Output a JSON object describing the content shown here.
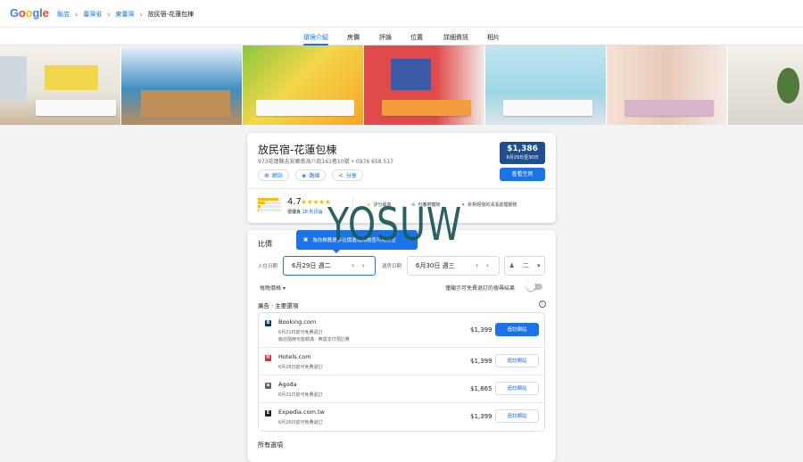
{
  "header": {
    "logo_letters": [
      "G",
      "o",
      "o",
      "g",
      "l",
      "e"
    ],
    "logo_colors": [
      "#4285f4",
      "#ea4335",
      "#fbbc05",
      "#4285f4",
      "#34a853",
      "#ea4335"
    ],
    "breadcrumbs": [
      "飯店",
      "臺灣省",
      "東臺灣",
      "放民宿-花蓮包棟"
    ]
  },
  "tabs": [
    "環境介紹",
    "房價",
    "評論",
    "位置",
    "詳細資訊",
    "相片"
  ],
  "active_tab": 0,
  "hotel": {
    "name": "放民宿-花蓮包棟",
    "address": "973花蓮縣吉安鄉南海八街161巷10號 • 0976 658 517",
    "price": "$1,386",
    "price_dates": "6月29日至30日",
    "check_label": "查看空房",
    "actions": [
      {
        "label": "網站",
        "icon": "globe-icon"
      },
      {
        "label": "路線",
        "icon": "directions-icon"
      },
      {
        "label": "分享",
        "icon": "share-icon"
      }
    ],
    "rating": "4.7",
    "stars": "★★★★★",
    "rating_label": "很優良",
    "rating_count": "28 則評論",
    "amenities": [
      "評分最高",
      "可攜帶寵物",
      "針對經營的清潔處理服務"
    ]
  },
  "compare": {
    "title": "比價",
    "tooltip": "為你推薦更多比價選項和檢查可用房型",
    "checkin_label": "入住日期",
    "checkin_value": "6月29日 週二",
    "checkout_label": "退房日期",
    "checkout_value": "6月30日 週三",
    "guests_value": "二",
    "nightly_label": "每晚價格",
    "free_cancel_label": "僅顯示可免費退訂的搜尋結果",
    "ad_label": "廣告 · 主要選項",
    "offers": [
      {
        "name": "Booking.com",
        "note1": "6月21日前可免費退訂",
        "note2": "飯店隨時可能額滿 · 無需支付預訂費",
        "price": "$1,399",
        "button": "造訪網站",
        "icon_letter": "B",
        "icon_color": "#003580",
        "primary": true
      },
      {
        "name": "Hotels.com",
        "note1": "6月26日前可免費退訂",
        "note2": "",
        "price": "$1,399",
        "button": "造訪網站",
        "icon_letter": "H",
        "icon_color": "#d32f2f",
        "primary": false
      },
      {
        "name": "Agoda",
        "note1": "6月21日前可免費退訂",
        "note2": "",
        "price": "$1,865",
        "button": "造訪網站",
        "icon_letter": "a",
        "icon_color": "#5f6368",
        "primary": false
      },
      {
        "name": "Expedia.com.tw",
        "note1": "6月26日前可免費退訂",
        "note2": "",
        "price": "$1,399",
        "button": "造訪網站",
        "icon_letter": "E",
        "icon_color": "#202124",
        "primary": false
      }
    ],
    "all_options": "所有選項"
  },
  "watermark": "YOSUW",
  "photo_colors": [
    "#e8e4dc",
    "#3f8fc2",
    "#f3d74a",
    "#e04a4a",
    "#9fd6e6",
    "#e8c9b8",
    "#d9d5cc"
  ]
}
